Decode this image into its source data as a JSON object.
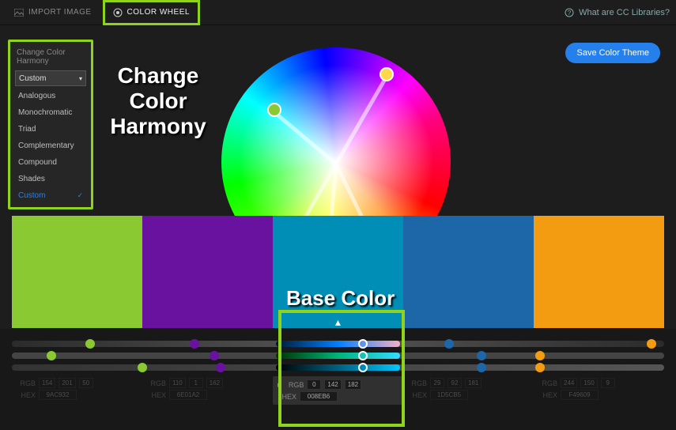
{
  "topbar": {
    "import_label": "IMPORT IMAGE",
    "wheel_label": "COLOR WHEEL",
    "help_label": "What are CC Libraries?"
  },
  "save_button": "Save Color Theme",
  "harmony": {
    "title": "Change Color Harmony",
    "selected": "Custom",
    "items": [
      "Analogous",
      "Monochromatic",
      "Triad",
      "Complementary",
      "Compound",
      "Shades",
      "Custom"
    ]
  },
  "annotations": {
    "change_harmony": "Change Color Harmony",
    "base_color": "Base Color"
  },
  "swatches": [
    {
      "color": "#8bc932",
      "rgb": [
        154,
        201,
        50
      ],
      "hex": "9AC932"
    },
    {
      "color": "#6a12a0",
      "rgb": [
        110,
        1,
        162
      ],
      "hex": "6E01A2"
    },
    {
      "color": "#008eb6",
      "rgb": [
        0,
        142,
        182
      ],
      "hex": "008EB6",
      "base": true
    },
    {
      "color": "#1d66a8",
      "rgb": [
        29,
        92,
        181
      ],
      "hex": "1D5CB5"
    },
    {
      "color": "#f39c12",
      "rgb": [
        244,
        150,
        9
      ],
      "hex": "F49609"
    }
  ],
  "labels": {
    "rgb": "RGB",
    "hex": "HEX"
  },
  "wheel_points": [
    {
      "angle": 140,
      "radius": 102,
      "color": "#8bc932"
    },
    {
      "angle": 60,
      "radius": 128,
      "color": "#ffd84a"
    },
    {
      "angle": 296,
      "radius": 125,
      "color": "#d040d0"
    },
    {
      "angle": 265,
      "radius": 125,
      "color": "#3a5fb0"
    },
    {
      "angle": 240,
      "radius": 140,
      "color": "#008eb6",
      "base": true
    }
  ],
  "sliders": [
    {
      "bg": "linear-gradient(90deg,#2b2b2b,#555,#2b2b2b)",
      "dots": [
        {
          "pos": 12,
          "c": "#8bc932"
        },
        {
          "pos": 28,
          "c": "#6a12a0"
        },
        {
          "pos": 67,
          "c": "#1d66a8"
        },
        {
          "pos": 98,
          "c": "#f39c12"
        }
      ]
    },
    {
      "bg": "linear-gradient(90deg,#444,#444)",
      "dots": [
        {
          "pos": 6,
          "c": "#8bc932"
        },
        {
          "pos": 31,
          "c": "#6a12a0"
        },
        {
          "pos": 72,
          "c": "#1d66a8"
        },
        {
          "pos": 81,
          "c": "#f39c12"
        }
      ]
    },
    {
      "bg": "linear-gradient(90deg,#333,#555)",
      "dots": [
        {
          "pos": 20,
          "c": "#8bc932"
        },
        {
          "pos": 32,
          "c": "#6a12a0"
        },
        {
          "pos": 72,
          "c": "#1d66a8"
        },
        {
          "pos": 81,
          "c": "#f39c12"
        }
      ]
    }
  ],
  "base_sliders": [
    "linear-gradient(90deg,#001a33,#0080ff,#f4b0c8)",
    "linear-gradient(90deg,#003300,#00b37a,#33ddff)",
    "linear-gradient(90deg,#000000,#006080,#00c8ff)"
  ]
}
